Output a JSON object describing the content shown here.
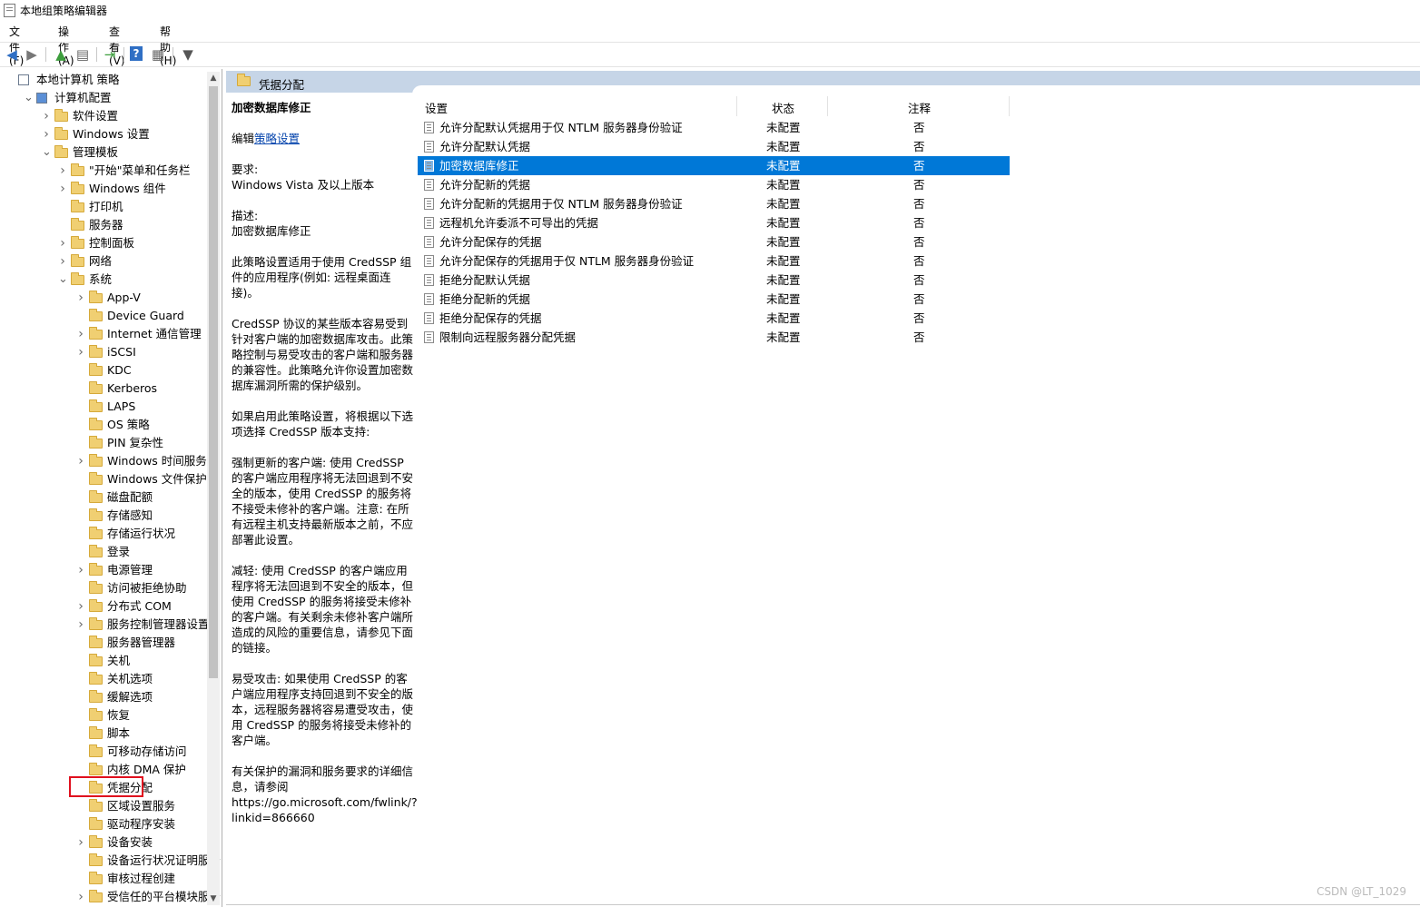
{
  "window": {
    "title": "本地组策略编辑器"
  },
  "menu": [
    "文件(F)",
    "操作(A)",
    "查看(V)",
    "帮助(H)"
  ],
  "tree": [
    {
      "label": "本地计算机 策略",
      "depth": 0,
      "expander": "none",
      "icon": "computer-policy-icon"
    },
    {
      "label": "计算机配置",
      "depth": 1,
      "expander": "expanded",
      "icon": "computer-icon"
    },
    {
      "label": "软件设置",
      "depth": 2,
      "expander": "collapsed",
      "icon": "folder-icon"
    },
    {
      "label": "Windows 设置",
      "depth": 2,
      "expander": "collapsed",
      "icon": "folder-icon"
    },
    {
      "label": "管理模板",
      "depth": 2,
      "expander": "expanded",
      "icon": "folder-icon"
    },
    {
      "label": "\"开始\"菜单和任务栏",
      "depth": 3,
      "expander": "collapsed",
      "icon": "folder-icon"
    },
    {
      "label": "Windows 组件",
      "depth": 3,
      "expander": "collapsed",
      "icon": "folder-icon"
    },
    {
      "label": "打印机",
      "depth": 3,
      "expander": "none",
      "icon": "folder-icon"
    },
    {
      "label": "服务器",
      "depth": 3,
      "expander": "none",
      "icon": "folder-icon"
    },
    {
      "label": "控制面板",
      "depth": 3,
      "expander": "collapsed",
      "icon": "folder-icon"
    },
    {
      "label": "网络",
      "depth": 3,
      "expander": "collapsed",
      "icon": "folder-icon"
    },
    {
      "label": "系统",
      "depth": 3,
      "expander": "expanded",
      "icon": "folder-icon"
    },
    {
      "label": "App-V",
      "depth": 4,
      "expander": "collapsed",
      "icon": "folder-icon"
    },
    {
      "label": "Device Guard",
      "depth": 4,
      "expander": "none",
      "icon": "folder-icon"
    },
    {
      "label": "Internet 通信管理",
      "depth": 4,
      "expander": "collapsed",
      "icon": "folder-icon"
    },
    {
      "label": "iSCSI",
      "depth": 4,
      "expander": "collapsed",
      "icon": "folder-icon"
    },
    {
      "label": "KDC",
      "depth": 4,
      "expander": "none",
      "icon": "folder-icon"
    },
    {
      "label": "Kerberos",
      "depth": 4,
      "expander": "none",
      "icon": "folder-icon"
    },
    {
      "label": "LAPS",
      "depth": 4,
      "expander": "none",
      "icon": "folder-icon"
    },
    {
      "label": "OS 策略",
      "depth": 4,
      "expander": "none",
      "icon": "folder-icon"
    },
    {
      "label": "PIN 复杂性",
      "depth": 4,
      "expander": "none",
      "icon": "folder-icon"
    },
    {
      "label": "Windows 时间服务",
      "depth": 4,
      "expander": "collapsed",
      "icon": "folder-icon"
    },
    {
      "label": "Windows 文件保护",
      "depth": 4,
      "expander": "none",
      "icon": "folder-icon"
    },
    {
      "label": "磁盘配额",
      "depth": 4,
      "expander": "none",
      "icon": "folder-icon"
    },
    {
      "label": "存储感知",
      "depth": 4,
      "expander": "none",
      "icon": "folder-icon"
    },
    {
      "label": "存储运行状况",
      "depth": 4,
      "expander": "none",
      "icon": "folder-icon"
    },
    {
      "label": "登录",
      "depth": 4,
      "expander": "none",
      "icon": "folder-icon"
    },
    {
      "label": "电源管理",
      "depth": 4,
      "expander": "collapsed",
      "icon": "folder-icon"
    },
    {
      "label": "访问被拒绝协助",
      "depth": 4,
      "expander": "none",
      "icon": "folder-icon"
    },
    {
      "label": "分布式 COM",
      "depth": 4,
      "expander": "collapsed",
      "icon": "folder-icon"
    },
    {
      "label": "服务控制管理器设置",
      "depth": 4,
      "expander": "collapsed",
      "icon": "folder-icon"
    },
    {
      "label": "服务器管理器",
      "depth": 4,
      "expander": "none",
      "icon": "folder-icon"
    },
    {
      "label": "关机",
      "depth": 4,
      "expander": "none",
      "icon": "folder-icon"
    },
    {
      "label": "关机选项",
      "depth": 4,
      "expander": "none",
      "icon": "folder-icon"
    },
    {
      "label": "缓解选项",
      "depth": 4,
      "expander": "none",
      "icon": "folder-icon"
    },
    {
      "label": "恢复",
      "depth": 4,
      "expander": "none",
      "icon": "folder-icon"
    },
    {
      "label": "脚本",
      "depth": 4,
      "expander": "none",
      "icon": "folder-icon"
    },
    {
      "label": "可移动存储访问",
      "depth": 4,
      "expander": "none",
      "icon": "folder-icon"
    },
    {
      "label": "内核 DMA 保护",
      "depth": 4,
      "expander": "none",
      "icon": "folder-icon"
    },
    {
      "label": "凭据分配",
      "depth": 4,
      "expander": "none",
      "icon": "folder-icon",
      "selected": true
    },
    {
      "label": "区域设置服务",
      "depth": 4,
      "expander": "none",
      "icon": "folder-icon"
    },
    {
      "label": "驱动程序安装",
      "depth": 4,
      "expander": "none",
      "icon": "folder-icon"
    },
    {
      "label": "设备安装",
      "depth": 4,
      "expander": "collapsed",
      "icon": "folder-icon"
    },
    {
      "label": "设备运行状况证明服务",
      "depth": 4,
      "expander": "none",
      "icon": "folder-icon"
    },
    {
      "label": "审核过程创建",
      "depth": 4,
      "expander": "none",
      "icon": "folder-icon"
    },
    {
      "label": "受信任的平台模块服务",
      "depth": 4,
      "expander": "collapsed",
      "icon": "folder-icon"
    }
  ],
  "right_header": {
    "title": "凭据分配"
  },
  "description": {
    "title": "加密数据库修正",
    "edit_prefix": "编辑",
    "edit_link": "策略设置",
    "requirement_label": "要求:",
    "requirement": "Windows Vista 及以上版本",
    "desc_label": "描述:",
    "body": "加密数据库修正\n\n此策略设置适用于使用 CredSSP 组件的应用程序(例如: 远程桌面连接)。\n\nCredSSP 协议的某些版本容易受到针对客户端的加密数据库攻击。此策略控制与易受攻击的客户端和服务器的兼容性。此策略允许你设置加密数据库漏洞所需的保护级别。\n\n如果启用此策略设置，将根据以下选项选择 CredSSP 版本支持:\n\n强制更新的客户端: 使用 CredSSP 的客户端应用程序将无法回退到不安全的版本，使用 CredSSP 的服务将不接受未修补的客户端。注意: 在所有远程主机支持最新版本之前，不应部署此设置。\n\n减轻: 使用 CredSSP 的客户端应用程序将无法回退到不安全的版本，但使用 CredSSP 的服务将接受未修补的客户端。有关剩余未修补客户端所造成的风险的重要信息，请参见下面的链接。\n\n易受攻击: 如果使用 CredSSP 的客户端应用程序支持回退到不安全的版本，远程服务器将容易遭受攻击，使用 CredSSP 的服务将接受未修补的客户端。\n\n有关保护的漏洞和服务要求的详细信息，请参阅\nhttps://go.microsoft.com/fwlink/?linkid=866660"
  },
  "table": {
    "headers": [
      "设置",
      "状态",
      "注释"
    ],
    "rows": [
      {
        "name": "允许分配默认凭据用于仅 NTLM 服务器身份验证",
        "state": "未配置",
        "comment": "否"
      },
      {
        "name": "允许分配默认凭据",
        "state": "未配置",
        "comment": "否"
      },
      {
        "name": "加密数据库修正",
        "state": "未配置",
        "comment": "否",
        "selected": true
      },
      {
        "name": "允许分配新的凭据",
        "state": "未配置",
        "comment": "否"
      },
      {
        "name": "允许分配新的凭据用于仅 NTLM 服务器身份验证",
        "state": "未配置",
        "comment": "否"
      },
      {
        "name": "远程机允许委派不可导出的凭据",
        "state": "未配置",
        "comment": "否"
      },
      {
        "name": "允许分配保存的凭据",
        "state": "未配置",
        "comment": "否"
      },
      {
        "name": "允许分配保存的凭据用于仅 NTLM 服务器身份验证",
        "state": "未配置",
        "comment": "否"
      },
      {
        "name": "拒绝分配默认凭据",
        "state": "未配置",
        "comment": "否"
      },
      {
        "name": "拒绝分配新的凭据",
        "state": "未配置",
        "comment": "否"
      },
      {
        "name": "拒绝分配保存的凭据",
        "state": "未配置",
        "comment": "否"
      },
      {
        "name": "限制向远程服务器分配凭据",
        "state": "未配置",
        "comment": "否"
      }
    ]
  },
  "watermark": "CSDN @LT_1029",
  "colors": {
    "selection": "#0078d7",
    "header_band": "#c6d5e7",
    "highlight_box": "#e0101e"
  }
}
